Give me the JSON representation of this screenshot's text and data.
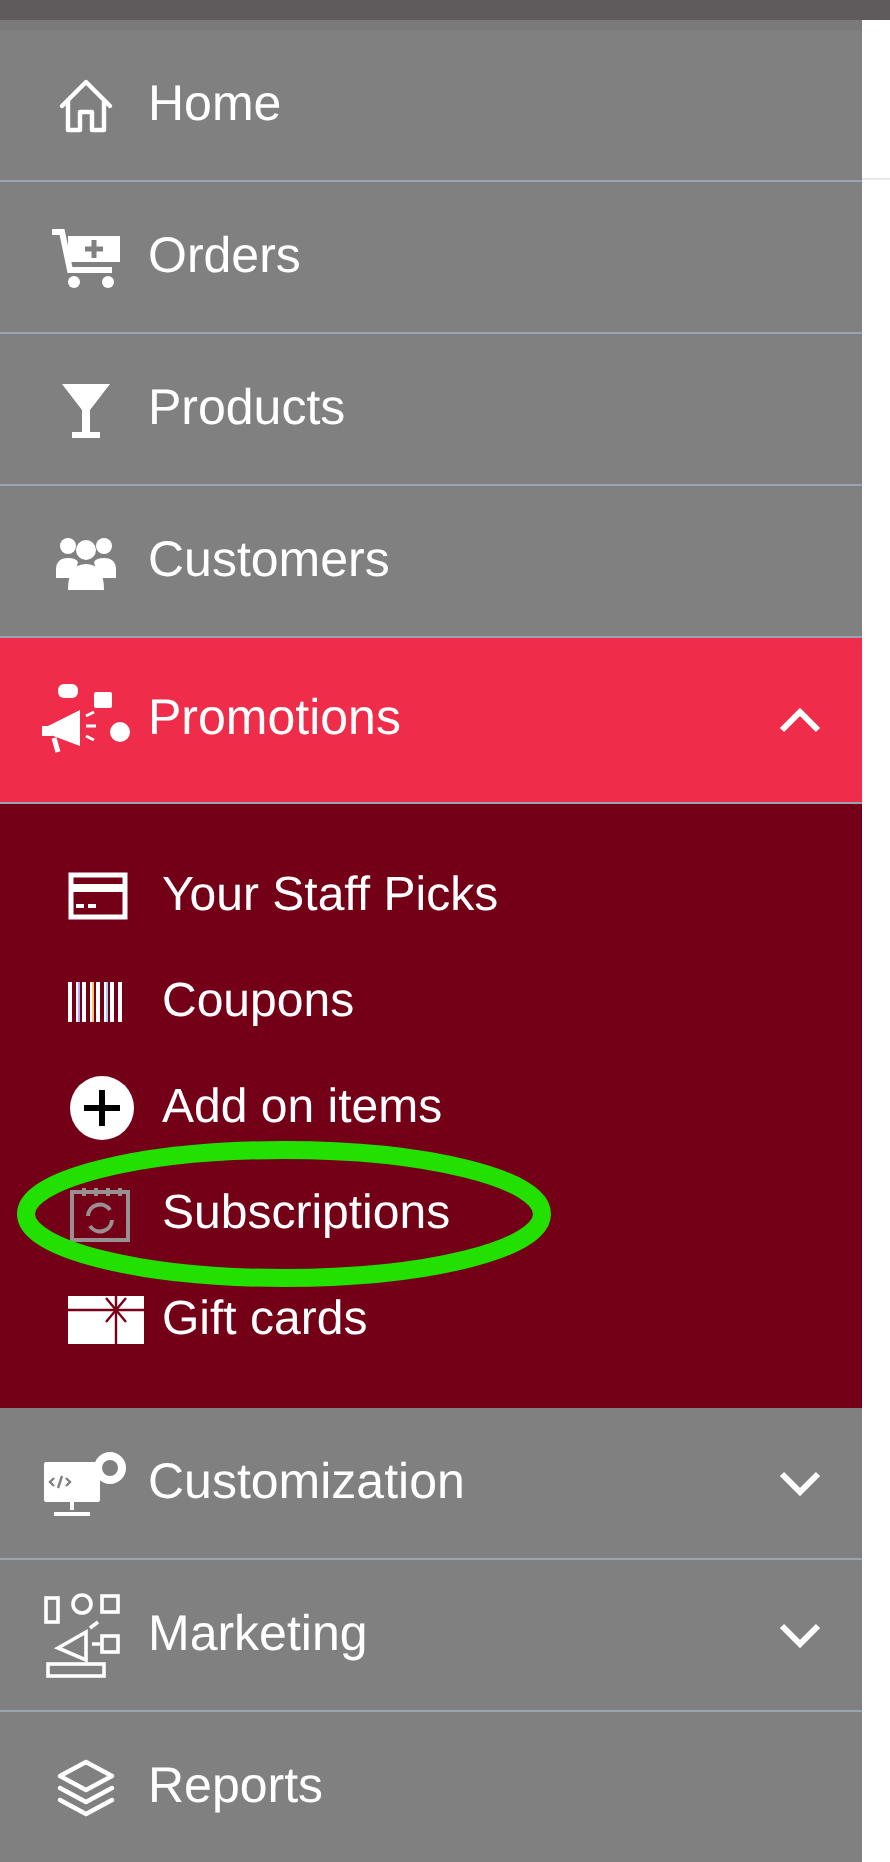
{
  "menu": [
    {
      "label": "Home",
      "selected": false
    },
    {
      "label": "Orders",
      "selected": false
    },
    {
      "label": "Products",
      "selected": false
    },
    {
      "label": "Customers",
      "selected": false
    },
    {
      "label": "Promotions",
      "selected": true,
      "expanded": true,
      "children": [
        {
          "label": "Your Staff Picks",
          "highlighted": false
        },
        {
          "label": "Coupons",
          "highlighted": false
        },
        {
          "label": "Add on items",
          "highlighted": false
        },
        {
          "label": "Subscriptions",
          "highlighted": true
        },
        {
          "label": "Gift cards",
          "highlighted": false
        }
      ]
    },
    {
      "label": "Customization",
      "selected": false,
      "expanded": false
    },
    {
      "label": "Marketing",
      "selected": false,
      "expanded": false
    },
    {
      "label": "Reports",
      "selected": false
    }
  ]
}
